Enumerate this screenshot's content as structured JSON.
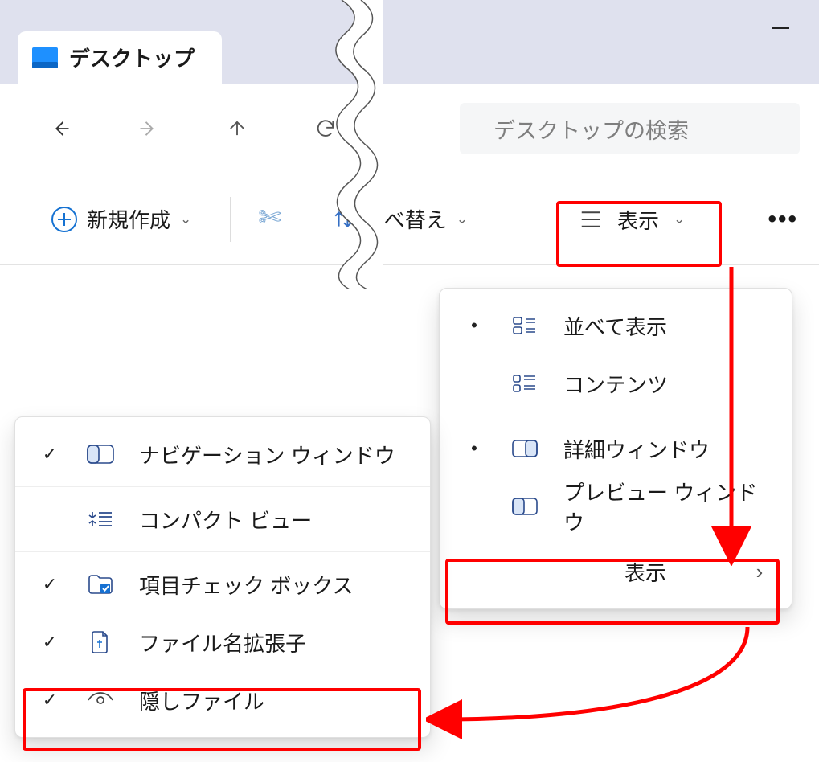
{
  "titlebar": {
    "tab_title": "デスクトップ"
  },
  "navbar": {
    "search_placeholder": "デスクトップの検索"
  },
  "toolbar": {
    "new_label": "新規作成",
    "sort_label": "並べ替え",
    "view_label": "表示",
    "more_label": "•••"
  },
  "view_menu": {
    "items": [
      {
        "label": "並べて表示",
        "bullet": true
      },
      {
        "label": "コンテンツ",
        "bullet": false
      },
      {
        "label": "詳細ウィンドウ",
        "bullet": true
      },
      {
        "label": "プレビュー ウィンドウ",
        "bullet": false
      }
    ],
    "show_label": "表示"
  },
  "show_menu": {
    "items": [
      {
        "label": "ナビゲーション ウィンドウ",
        "checked": true
      },
      {
        "label": "コンパクト ビュー",
        "checked": false
      },
      {
        "label": "項目チェック ボックス",
        "checked": true
      },
      {
        "label": "ファイル名拡張子",
        "checked": true
      },
      {
        "label": "隠しファイル",
        "checked": true
      }
    ]
  }
}
